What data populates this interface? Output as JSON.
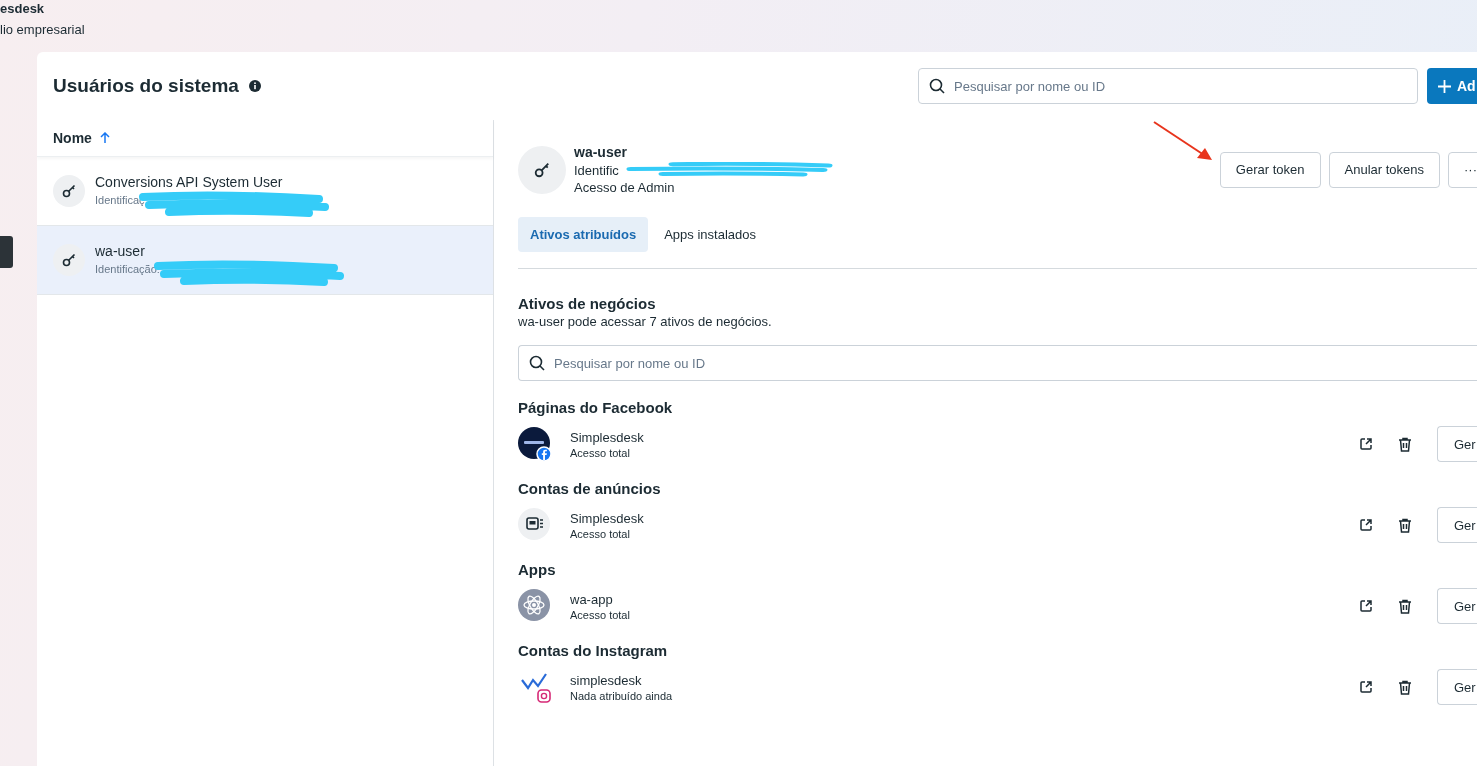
{
  "brand": {
    "name": "esdesk",
    "subtitle": "lio empresarial"
  },
  "panel": {
    "title": "Usuários do sistema",
    "search": {
      "placeholder": "Pesquisar por nome ou ID"
    },
    "add_button": "Ad"
  },
  "list": {
    "column": "Nome"
  },
  "users": [
    {
      "name": "Conversions API System User",
      "id": "Identificaç",
      "selected": false
    },
    {
      "name": "wa-user",
      "id": "Identificação:",
      "selected": true
    }
  ],
  "detail": {
    "name": "wa-user",
    "id": "Identific",
    "access": "Acesso de Admin",
    "actions": [
      "Gerar token",
      "Anular tokens",
      "···"
    ]
  },
  "tabs": [
    {
      "label": "Ativos atribuídos",
      "selected": true
    },
    {
      "label": "Apps instalados",
      "selected": false
    }
  ],
  "assets": {
    "title": "Ativos de negócios",
    "description": "wa-user pode acessar 7 ativos de negócios.",
    "search": {
      "placeholder": "Pesquisar por nome ou ID"
    }
  },
  "groups": [
    {
      "title": "Páginas do Facebook",
      "items": [
        {
          "kind": "page",
          "name": "Simplesdesk",
          "access": "Acesso total",
          "button": "Ger"
        }
      ]
    },
    {
      "title": "Contas de anúncios",
      "items": [
        {
          "kind": "ad_account",
          "name": "Simplesdesk",
          "access": "Acesso total",
          "button": "Ger"
        }
      ]
    },
    {
      "title": "Apps",
      "items": [
        {
          "kind": "app",
          "name": "wa-app",
          "access": "Acesso total",
          "button": "Ger"
        }
      ]
    },
    {
      "title": "Contas do Instagram",
      "items": [
        {
          "kind": "instagram",
          "name": "simplesdesk",
          "access": "Nada atribuído ainda",
          "button": "Ger"
        }
      ]
    }
  ]
}
